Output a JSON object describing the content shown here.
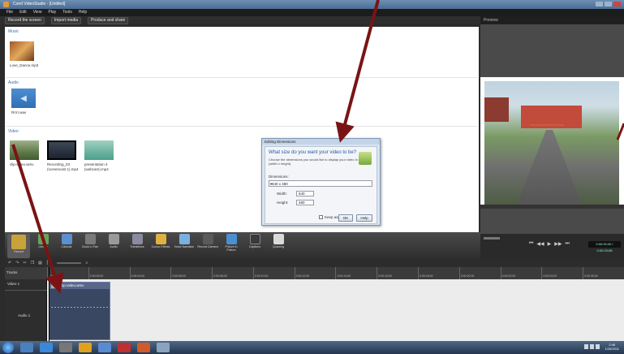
{
  "window": {
    "title": "Corel VideoStudio - [Untitled]"
  },
  "menubar": {
    "items": [
      "File",
      "Edit",
      "View",
      "Play",
      "Tools",
      "Help"
    ]
  },
  "library_toolbar": {
    "record_label": "Record the screen",
    "import_label": "Import media",
    "produce_label": "Produce and share"
  },
  "preview_header": {
    "label": "Preview"
  },
  "library": {
    "sections": [
      {
        "title": "Music",
        "items": [
          {
            "caption": "Love_Dance.mp3",
            "icon": "music-icon"
          }
        ]
      },
      {
        "title": "Audio",
        "items": [
          {
            "caption": "Rrrrr.wav",
            "icon": "audio-icon"
          }
        ]
      },
      {
        "title": "Video",
        "items": [
          {
            "caption": "clip-video.wmv",
            "icon": "video-icon"
          },
          {
            "caption": "Recording_03 (screencast 1).mp4",
            "icon": "video-icon"
          },
          {
            "caption": "presentation 4 (webcam).mp4",
            "icon": "video-icon"
          }
        ]
      }
    ]
  },
  "dialog": {
    "title": "Editing Dimensions",
    "heading": "What size do you want your video to be?",
    "description": "Choose the dimensions you would like to display your video in (width x height).",
    "resolution_label": "Dimensions:",
    "resolution_value": "640 x 480",
    "width_label": "Width:",
    "width_value": "640",
    "height_label": "Height:",
    "height_value": "480",
    "keep_aspect_label": "Keep aspect ratio",
    "ok_label": "OK",
    "help_label": "Help"
  },
  "preview": {
    "caption": "~~~~~~~~~~~~"
  },
  "ribbon": {
    "items": [
      {
        "label": "Record",
        "icon": "record-icon",
        "color": "#c9a23a"
      },
      {
        "label": "Library",
        "icon": "library-icon",
        "color": "#6aa35a"
      },
      {
        "label": "Callouts",
        "icon": "callouts-icon",
        "color": "#5a8fd0"
      },
      {
        "label": "Zoom-n-Pan",
        "icon": "zoom-icon",
        "color": "#7a7a7a"
      },
      {
        "label": "Audio",
        "icon": "audio-tool-icon",
        "color": "#9a9a9a"
      },
      {
        "label": "Transitions",
        "icon": "transitions-icon",
        "color": "#8a8aa0"
      },
      {
        "label": "Cursor Effects",
        "icon": "cursor-icon",
        "color": "#e0b040"
      },
      {
        "label": "Voice Narration",
        "icon": "mic-icon",
        "color": "#7ab0e0"
      },
      {
        "label": "Record Camera",
        "icon": "camera-icon",
        "color": "#5a5a5a"
      },
      {
        "label": "Picture in Picture",
        "icon": "pip-icon",
        "color": "#4a90d0"
      },
      {
        "label": "Captions",
        "icon": "captions-icon",
        "color": "#3a3a3a"
      },
      {
        "label": "Quizzing",
        "icon": "quiz-icon",
        "color": "#dadada"
      }
    ]
  },
  "playback": {
    "timecode": "0:00:00;00 / 0:00:23;08"
  },
  "timeline": {
    "toolbar_label": "Tracks",
    "ruler": [
      "0:00:00;00",
      "0:00:02;00",
      "0:00:04;00",
      "0:00:06;00",
      "0:00:08;00",
      "0:00:10;00",
      "0:00:12;00",
      "0:00:14;00",
      "0:00:16;00",
      "0:00:18;00",
      "0:00:20;00",
      "0:00:22;00",
      "0:00:24;00",
      "0:00:26;00"
    ],
    "track1_label": "Video 1",
    "track2_label": "Audio 1",
    "clip_label": "clip-video.wmv"
  },
  "taskbar": {
    "time": "2:46",
    "date": "1/20/2011"
  },
  "colors": {
    "annotation_arrow": "#7a1414",
    "title_bar": "#4b6d94",
    "dialog_accent": "#1f5aa6"
  }
}
